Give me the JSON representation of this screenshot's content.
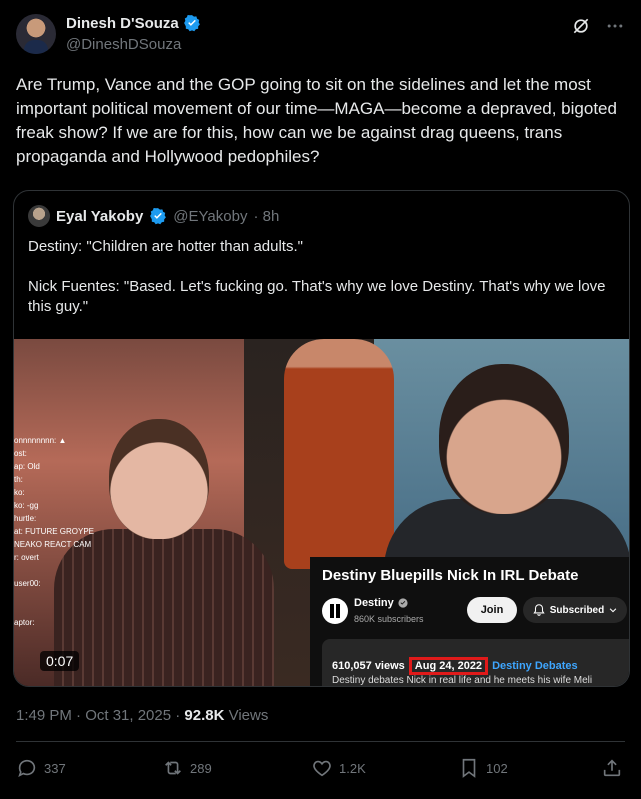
{
  "author": {
    "display_name": "Dinesh D'Souza",
    "handle": "@DineshDSouza"
  },
  "tweet_text": "Are Trump, Vance and the GOP going to sit on the sidelines and let the most important political movement of our time—MAGA—become a depraved, bigoted freak show? If we are for this, how can we be against drag queens, trans propaganda and Hollywood pedophiles?",
  "quoted": {
    "display_name": "Eyal Yakoby",
    "handle": "@EYakoby",
    "time": "· 8h",
    "lines": [
      "Destiny: \"Children are hotter than adults.\"",
      "Nick Fuentes: \"Based. Let's fucking go. That's why we love Destiny. That's why we love this guy.\""
    ],
    "video": {
      "duration": "0:07",
      "chat_lines": [
        "onnnnnnnn: ▲",
        "ost:",
        "ap: Old",
        "th:",
        "ko:",
        "ko: -gg",
        "hurtle:",
        "at: FUTURE GROYPER",
        "NEAKO REACT CAM",
        "r: overt",
        "",
        "user00:",
        "",
        "",
        "aptor:"
      ],
      "yt": {
        "title": "Destiny Bluepills Nick In IRL Debate",
        "channel": "Destiny",
        "subscribers": "860K subscribers",
        "join": "Join",
        "subscribed": "Subscribed",
        "views": "610,057 views",
        "date": "Aug 24, 2022",
        "playlist": "Destiny Debates",
        "description": "Destiny debates Nick in real life and he meets his wife Meli"
      }
    }
  },
  "meta": {
    "time": "1:49 PM · Oct 31, 2025 · ",
    "views_count": "92.8K",
    "views_label": " Views"
  },
  "actions": {
    "replies": "337",
    "reposts": "289",
    "likes": "1.2K",
    "bookmarks": "102"
  },
  "colors": {
    "background": "#000000",
    "text": "#e7e9ea",
    "muted": "#71767b",
    "verified": "#1d9bf0",
    "highlight_box": "#e01a1a"
  }
}
